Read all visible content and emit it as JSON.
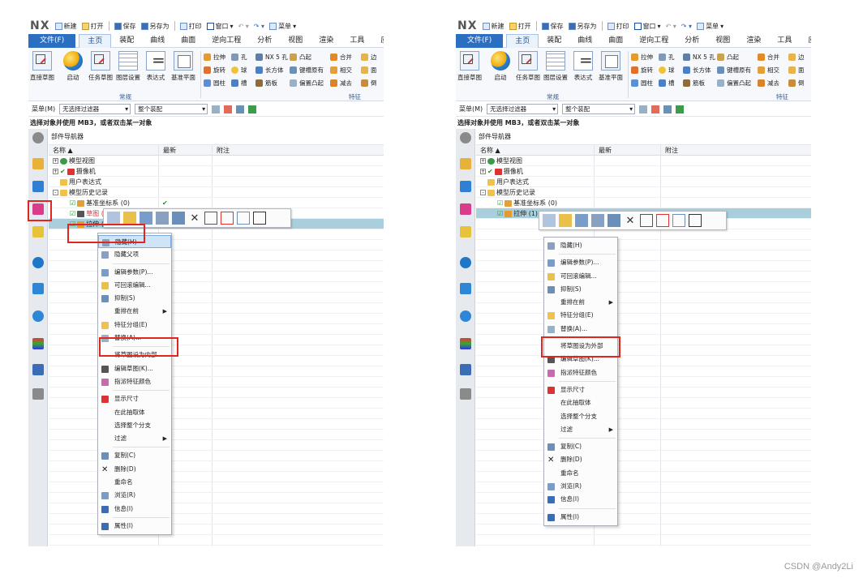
{
  "app": {
    "logo": "NX",
    "quick_access": [
      "新建",
      "打开",
      "保存",
      "另存为",
      "打印",
      "窗口",
      "菜单"
    ]
  },
  "tabs": [
    "文件(F)",
    "主页",
    "装配",
    "曲线",
    "曲面",
    "逆向工程",
    "分析",
    "视图",
    "渲染",
    "工具",
    "应用模块"
  ],
  "ribbon": {
    "big_buttons": [
      "直接草图",
      "启动",
      "任务草图",
      "图层设置",
      "表达式",
      "基准平面"
    ],
    "small_col1": [
      "拉伸",
      "旋转",
      "圆柱"
    ],
    "small_col2": [
      "孔",
      "球",
      "槽"
    ],
    "small_col3": [
      "NX 5 孔",
      "长方体",
      "筋板"
    ],
    "small_col4": [
      "凸起",
      "键槽原有",
      "偏置凸起"
    ],
    "small_col5": [
      "合并",
      "相交",
      "减去"
    ],
    "small_col6": [
      "边",
      "面",
      "倒"
    ],
    "group_labels": [
      "常规",
      "特征"
    ]
  },
  "filterbar": {
    "menu_label": "菜单(M)",
    "filter_value": "无选择过滤器",
    "scope_value": "整个装配"
  },
  "status_text": "选择对象并使用 MB3，或者双击某一对象",
  "navigator": {
    "title": "部件导航器",
    "columns": [
      "名称 ▲",
      "最新",
      "附注"
    ]
  },
  "left": {
    "tree": [
      {
        "label": "模型视图",
        "expander": "+"
      },
      {
        "label": "摄像机",
        "expander": "+",
        "check": true
      },
      {
        "label": "用户表达式",
        "expander": ""
      },
      {
        "label": "模型历史记录",
        "expander": "-"
      },
      {
        "label": "基准坐标系 (0)",
        "check": true
      },
      {
        "label": "草图 (1)",
        "check": true
      },
      {
        "label": "拉伸 (2)",
        "check": true
      }
    ],
    "menu": [
      {
        "label": "隐藏(H)",
        "selected": true
      },
      {
        "label": "隐藏父项"
      },
      {
        "sep": true
      },
      {
        "label": "编辑参数(P)..."
      },
      {
        "label": "可回滚编辑..."
      },
      {
        "label": "抑制(S)"
      },
      {
        "label": "重排在前",
        "submenu": true
      },
      {
        "label": "特征分组(E)"
      },
      {
        "label": "替换(A)..."
      },
      {
        "sep": true
      },
      {
        "label": "将草图设为内部"
      },
      {
        "label": "编辑草图(K)..."
      },
      {
        "label": "指派特征颜色"
      },
      {
        "sep": true
      },
      {
        "label": "显示尺寸"
      },
      {
        "label": "在此抽取体"
      },
      {
        "label": "选择整个分支"
      },
      {
        "label": "过滤",
        "submenu": true
      },
      {
        "sep": true
      },
      {
        "label": "复制(C)"
      },
      {
        "label": "删除(D)"
      },
      {
        "label": "重命名"
      },
      {
        "label": "浏览(R)"
      },
      {
        "label": "信息(I)"
      },
      {
        "sep": true
      },
      {
        "label": "属性(I)"
      }
    ]
  },
  "right": {
    "tree": [
      {
        "label": "模型视图",
        "expander": "+"
      },
      {
        "label": "摄像机",
        "expander": "+",
        "check": true
      },
      {
        "label": "用户表达式",
        "expander": ""
      },
      {
        "label": "模型历史记录",
        "expander": "-"
      },
      {
        "label": "基准坐标系 (0)",
        "check": true
      },
      {
        "label": "拉伸 (1)",
        "check": true
      }
    ],
    "menu": [
      {
        "label": "隐藏(H)"
      },
      {
        "sep": true
      },
      {
        "label": "编辑参数(P)..."
      },
      {
        "label": "可回滚编辑..."
      },
      {
        "label": "抑制(S)"
      },
      {
        "label": "重排在前",
        "submenu": true
      },
      {
        "label": "特征分组(E)"
      },
      {
        "label": "替换(A)..."
      },
      {
        "sep": true
      },
      {
        "label": "将草图设为外部"
      },
      {
        "label": "编辑草图(K)..."
      },
      {
        "label": "指派特征颜色"
      },
      {
        "sep": true
      },
      {
        "label": "显示尺寸"
      },
      {
        "label": "在此抽取体"
      },
      {
        "label": "选择整个分支"
      },
      {
        "label": "过滤",
        "submenu": true
      },
      {
        "sep": true
      },
      {
        "label": "复制(C)"
      },
      {
        "label": "删除(D)"
      },
      {
        "label": "重命名"
      },
      {
        "label": "浏览(R)"
      },
      {
        "label": "信息(I)"
      },
      {
        "sep": true
      },
      {
        "label": "属性(I)"
      }
    ]
  },
  "watermark": "CSDN @Andy2Li",
  "colors": {
    "file_tab": "#2b6fc2",
    "highlight_row": "#a9cfdc",
    "red_box": "#e0261e",
    "check": "#1c9c22"
  }
}
